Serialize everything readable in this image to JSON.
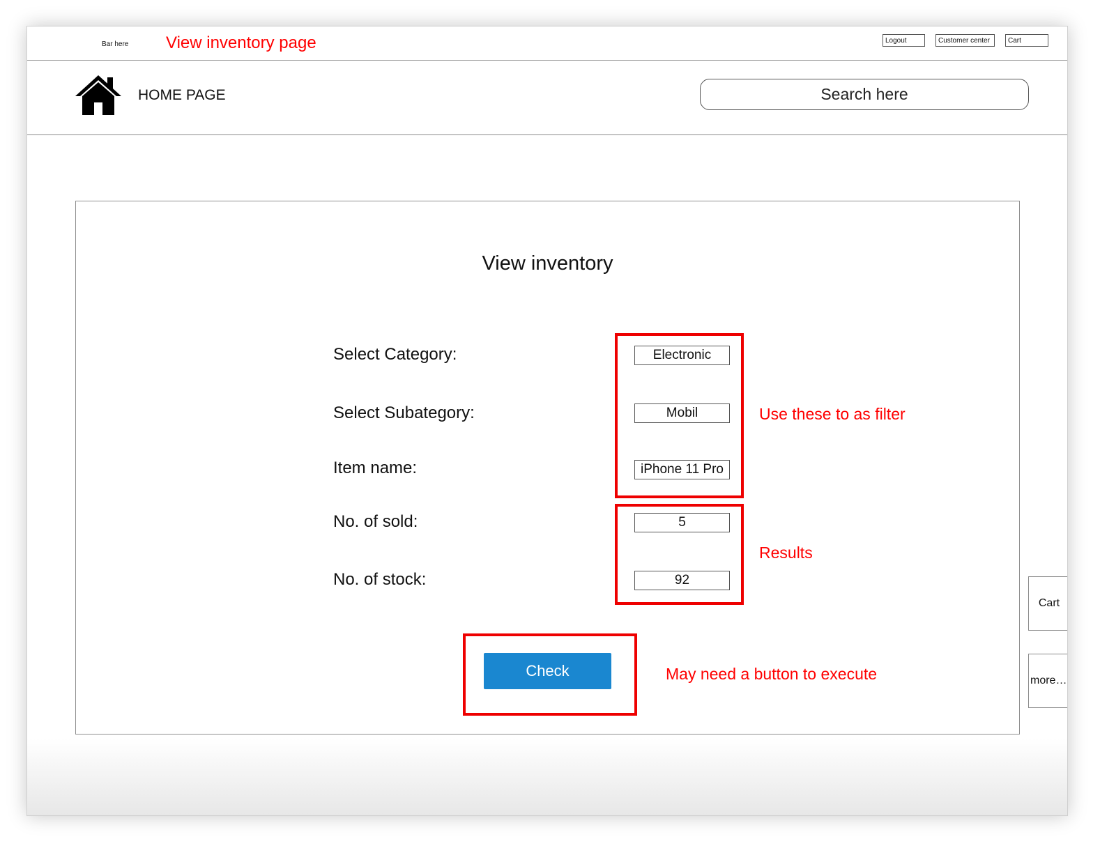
{
  "topbar": {
    "bar_label": "Bar here",
    "page_label": "View inventory page",
    "buttons": {
      "logout": "Logout",
      "customer_center": "Customer center",
      "cart": "Cart"
    }
  },
  "header": {
    "home_label": "HOME PAGE",
    "search_text": "Search here",
    "home_icon": "home-icon"
  },
  "panel": {
    "title": "View inventory",
    "fields": {
      "category": {
        "label": "Select Category:",
        "value": "Electronic"
      },
      "subcategory": {
        "label": "Select Subategory:",
        "value": "Mobil"
      },
      "item_name": {
        "label": "Item name:",
        "value": "iPhone 11 Pro"
      },
      "sold": {
        "label": "No. of sold:",
        "value": "5"
      },
      "stock": {
        "label": "No. of stock:",
        "value": "92"
      }
    },
    "check_button": "Check"
  },
  "annotations": {
    "filter_note": "Use these to as filter",
    "results_note": "Results",
    "button_note": "May need a button to execute",
    "color": "#ff0000"
  },
  "side_tabs": {
    "cart": "Cart",
    "more": "more…"
  },
  "colors": {
    "button_blue": "#1a87d0",
    "annotation_red": "#ff0000"
  }
}
